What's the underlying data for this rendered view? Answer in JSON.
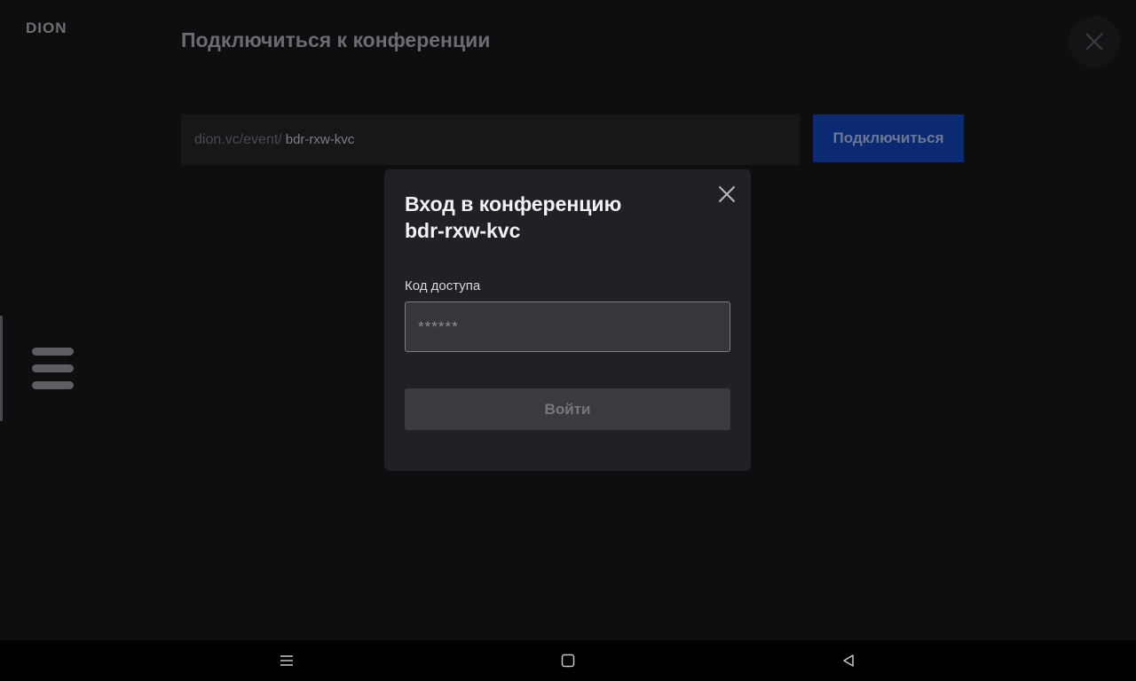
{
  "app": {
    "logo": "DION",
    "page_title": "Подключиться к конференции",
    "url_prefix": "dion.vc/event/",
    "url_code": "bdr-rxw-kvc",
    "connect_label": "Подключиться"
  },
  "modal": {
    "title_line1": "Вход в конференцию",
    "title_line2": "bdr-rxw-kvc",
    "field_label": "Код доступа",
    "field_placeholder": "******",
    "field_value": "",
    "submit_label": "Войти"
  },
  "icons": {
    "top_close": "close-icon",
    "modal_close": "close-icon",
    "side_menu": "hamburger-icon",
    "nav_recents": "recents-icon",
    "nav_home": "home-icon",
    "nav_back": "back-icon"
  },
  "colors": {
    "accent": "#0b2a72",
    "modal_bg": "#212125",
    "page_bg": "#0e0e10"
  }
}
